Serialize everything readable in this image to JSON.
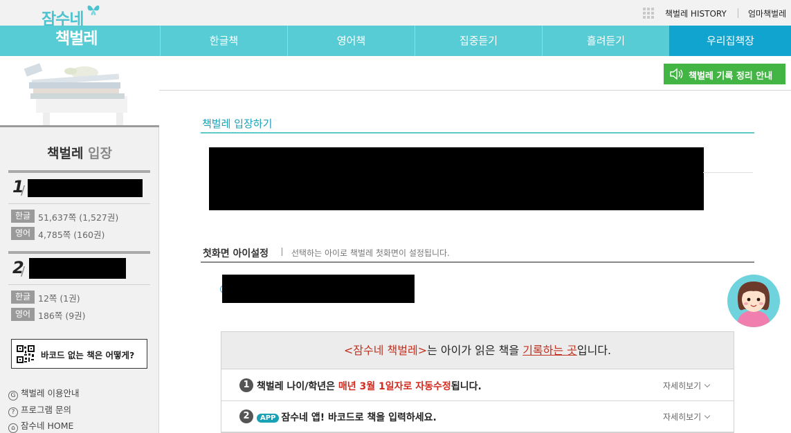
{
  "logo": {
    "line1": "잠수네",
    "line2": "책벌레"
  },
  "util": {
    "history_label": "책벌레 HISTORY",
    "mom_label": "엄마책벌레"
  },
  "nav": {
    "items": [
      {
        "label": "한글책"
      },
      {
        "label": "영어책"
      },
      {
        "label": "집중듣기"
      },
      {
        "label": "흘려듣기"
      },
      {
        "label": "우리집책장"
      }
    ],
    "active_index": 4
  },
  "record_button": {
    "label": "책벌레 기록 정리 안내"
  },
  "sidebar": {
    "title_main": "책벌레",
    "title_highlight": " 입장",
    "children": [
      {
        "number": "1",
        "korean_tag": "한글",
        "korean_stat": "51,637쪽 (1,527권)",
        "english_tag": "영어",
        "english_stat": "4,785쪽 (160권)"
      },
      {
        "number": "2",
        "korean_tag": "한글",
        "korean_stat": "12쪽 (1권)",
        "english_tag": "영어",
        "english_stat": "186쪽 (9권)"
      }
    ],
    "barcode_button": "바코드 없는 책은 어떻게?",
    "links": [
      {
        "icon_char": "G",
        "label": "책벌레 이용안내"
      },
      {
        "icon_char": "?",
        "label": "프로그램 문의"
      },
      {
        "icon_char": "⌂",
        "label": "잠수네 HOME"
      }
    ]
  },
  "main": {
    "section_title": "책벌레 입장하기",
    "first_screen_title": "첫화면 아이설정",
    "first_screen_desc": "선택하는 아이로 책벌레 첫화면이 설정됩니다.",
    "info_heading_pre": "<잠수네 책벌레>",
    "info_heading_mid": "는 아이가 읽은 책을 ",
    "info_heading_ul": "기록하는 곳",
    "info_heading_post": "입니다.",
    "info_rows": [
      {
        "num": "1",
        "pre": "책벌레 나이/학년은 ",
        "red": "매년 3월 1일자로 자동수정",
        "post": "됩니다.",
        "more": "자세히보기"
      },
      {
        "num": "2",
        "badge": "APP",
        "text": "잠수네 앱! 바코드로 책을 입력하세요.",
        "more": "자세히보기"
      }
    ]
  },
  "colors": {
    "nav_bg": "#58ccd5",
    "nav_active": "#10a4cf",
    "accent_teal": "#17a2b8",
    "green_button": "#42b544",
    "highlight_red": "#c0301f"
  }
}
